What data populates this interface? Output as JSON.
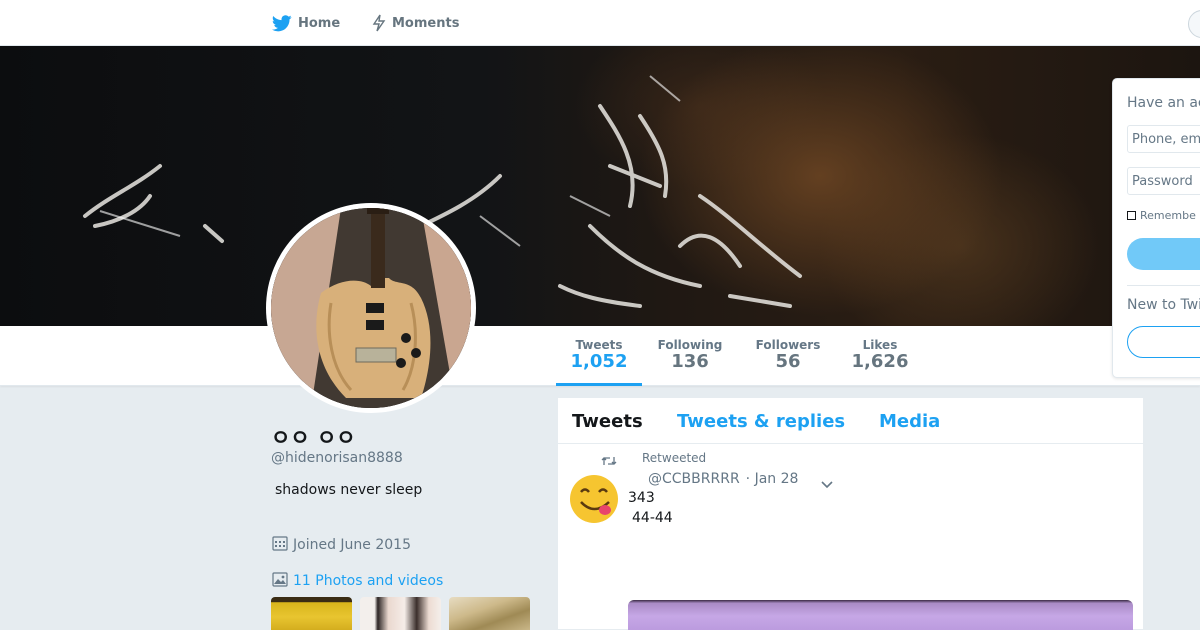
{
  "nav": {
    "home_label": "Home",
    "moments_label": "Moments"
  },
  "profile": {
    "name": "ㅇㅇ ㅇㅇ",
    "handle": "@hidenorisan8888",
    "bio": "shadows never sleep",
    "joined": "Joined June 2015",
    "photos_link": "11 Photos and videos"
  },
  "stats": {
    "tweets": {
      "label": "Tweets",
      "value": "1,052"
    },
    "following": {
      "label": "Following",
      "value": "136"
    },
    "followers": {
      "label": "Followers",
      "value": "56"
    },
    "likes": {
      "label": "Likes",
      "value": "1,626"
    }
  },
  "timeline": {
    "tabs": [
      "Tweets",
      "Tweets & replies",
      "Media"
    ],
    "active_tab": "Tweets",
    "tweet": {
      "retweet_label": "Retweeted",
      "username": "@CCBBRRRR",
      "date": "· Jan 28",
      "text_line1": "343",
      "text_line2": "44-44"
    }
  },
  "login": {
    "title": "Have an ac",
    "phone_placeholder": "Phone, em",
    "password_placeholder": "Password",
    "remember_label": "Remembe",
    "new_to": "New to Twi"
  },
  "colors": {
    "accent": "#1da1f2",
    "background": "#e6ecf0",
    "muted": "#657786"
  },
  "icons": {
    "home": "twitter-bird-icon",
    "moments": "lightning-icon",
    "calendar": "calendar-icon",
    "photo": "photo-icon",
    "retweet": "retweet-icon",
    "caret": "chevron-down-icon"
  }
}
